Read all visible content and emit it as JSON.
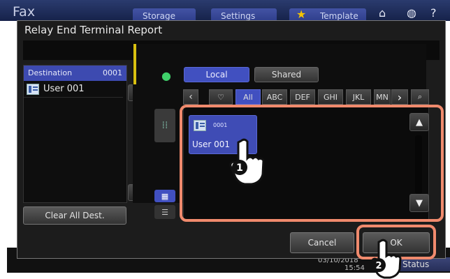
{
  "app": {
    "title": "Fax",
    "tabs": [
      "Storage",
      "Settings",
      "Template"
    ]
  },
  "dialog": {
    "title": "Relay End Terminal Report",
    "destination_header": "Destination",
    "destination_count": "0001",
    "destinations": [
      {
        "label": "User 001",
        "icon": "fax-icon"
      }
    ],
    "clear_label": "Clear All Dest.",
    "cancel_label": "Cancel",
    "ok_label": "OK"
  },
  "book": {
    "tabs": {
      "local": "Local",
      "shared": "Shared"
    },
    "index": [
      "All",
      "ABC",
      "DEF",
      "GHI",
      "JKL",
      "MN"
    ],
    "entries": [
      {
        "number": "0001",
        "name": "User 001",
        "icon": "fax-icon"
      }
    ]
  },
  "status_bar": {
    "date": "03/10/2018",
    "time": "15:54",
    "status_label": "Status"
  },
  "steps": [
    "1",
    "2"
  ],
  "colors": {
    "accent": "#4150c0",
    "highlight": "#f08a6d",
    "active_bar": "#d8c010"
  }
}
